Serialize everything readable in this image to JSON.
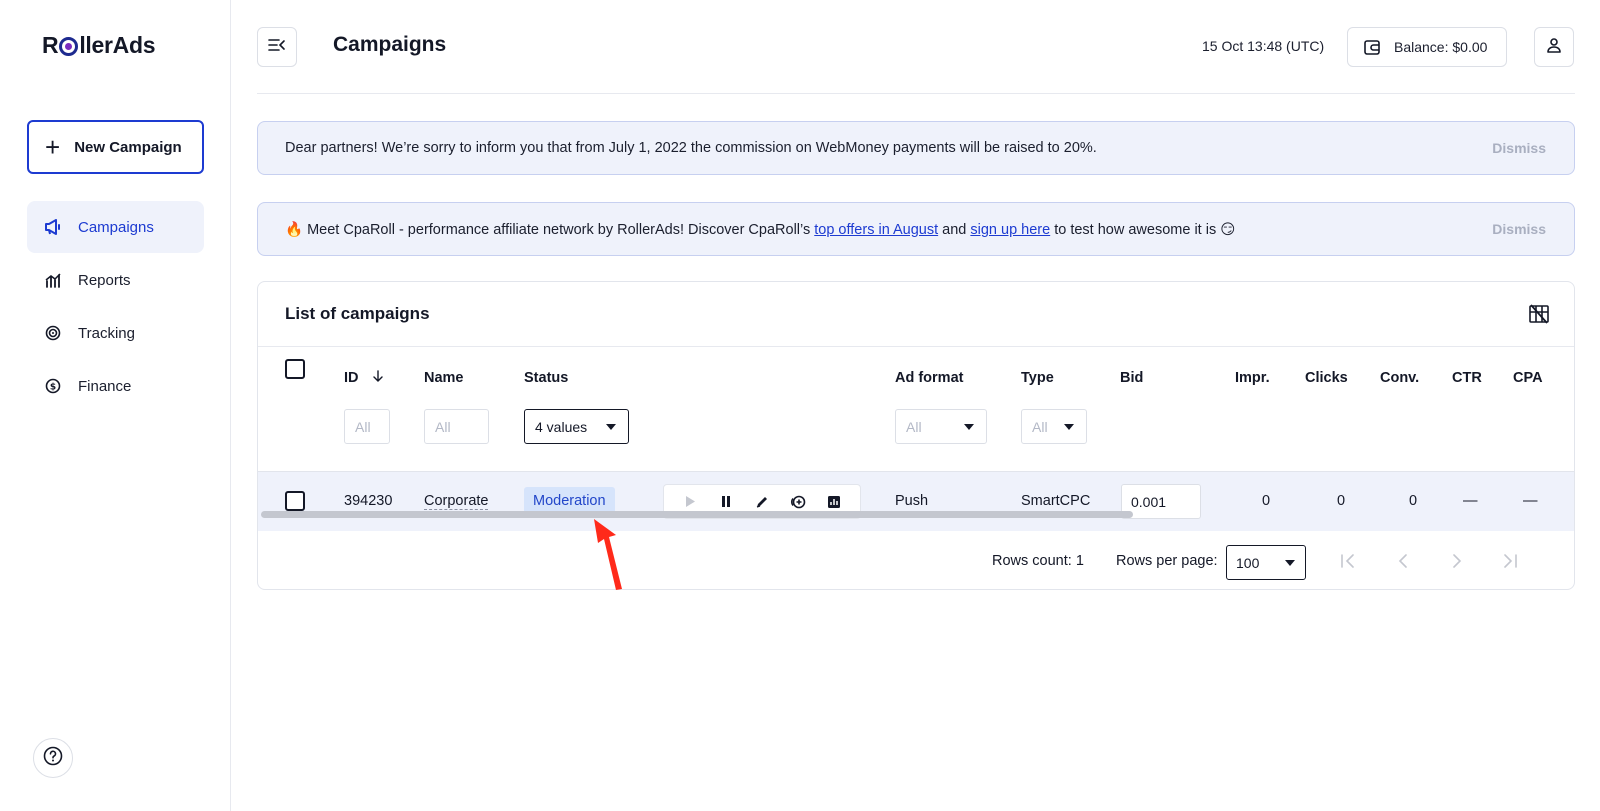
{
  "logo": {
    "before": "R",
    "after": "llerAds"
  },
  "sidebar": {
    "new_campaign_label": "New Campaign",
    "items": [
      {
        "label": "Campaigns",
        "icon": "megaphone-icon",
        "active": true
      },
      {
        "label": "Reports",
        "icon": "chart-icon",
        "active": false
      },
      {
        "label": "Tracking",
        "icon": "target-icon",
        "active": false
      },
      {
        "label": "Finance",
        "icon": "dollar-icon",
        "active": false
      }
    ]
  },
  "header": {
    "title": "Campaigns",
    "datetime": "15 Oct 13:48 (UTC)",
    "balance": "Balance: $0.00"
  },
  "banners": [
    {
      "text": "Dear partners! We’re sorry to inform you that from July 1, 2022 the commission on WebMoney payments will be raised to 20%.",
      "dismiss": "Dismiss"
    },
    {
      "prefix": "🔥 Meet CpaRoll - performance affiliate network by RollerAds! Discover CpaRoll’s ",
      "link1": "top offers in August",
      "middle": " and ",
      "link2": "sign up here",
      "suffix": " to test how awesome it is 😏",
      "dismiss": "Dismiss"
    }
  ],
  "list": {
    "title": "List of campaigns",
    "columns": {
      "id": "ID",
      "name": "Name",
      "status": "Status",
      "ad_format": "Ad format",
      "type": "Type",
      "bid": "Bid",
      "impr": "Impr.",
      "clicks": "Clicks",
      "conv": "Conv.",
      "ctr": "CTR",
      "cpa": "CPA"
    },
    "filters": {
      "id": "All",
      "name": "All",
      "status": "4 values",
      "ad_format": "All",
      "type": "All"
    },
    "rows": [
      {
        "id": "394230",
        "name": "Corporate",
        "status": "Moderation",
        "ad_format": "Push",
        "type": "SmartCPC",
        "bid": "0.001",
        "impr": "0",
        "clicks": "0",
        "conv": "0",
        "ctr": "—",
        "cpa": "—"
      }
    ],
    "footer": {
      "rows_count": "Rows count: 1",
      "rows_per_page_label": "Rows per page:",
      "rows_per_page": "100"
    }
  },
  "colors": {
    "accent": "#1d3bd1",
    "banner_bg": "#eff2fb",
    "badge_bg": "#d6e4fb",
    "annotation": "#ff2a1a"
  }
}
